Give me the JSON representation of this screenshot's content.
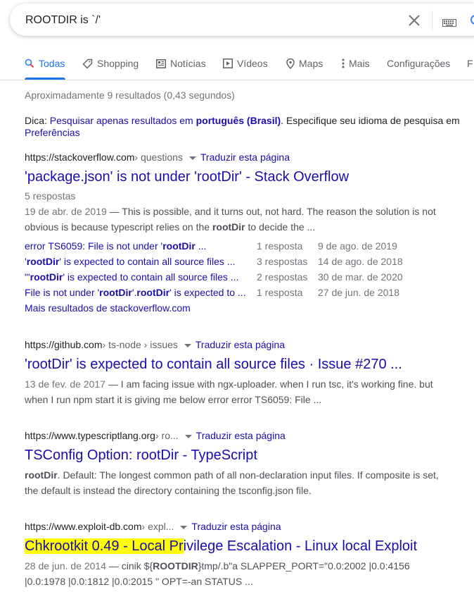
{
  "search": {
    "query": "ROOTDIR is `/'"
  },
  "tabs": [
    {
      "label": "Todas",
      "icon": "search-icon",
      "active": true
    },
    {
      "label": "Shopping",
      "icon": "tag-icon"
    },
    {
      "label": "Notícias",
      "icon": "news-icon"
    },
    {
      "label": "Vídeos",
      "icon": "video-icon"
    },
    {
      "label": "Maps",
      "icon": "map-pin-icon"
    },
    {
      "label": "Mais",
      "icon": "more-vert-icon"
    },
    {
      "label": "Configurações"
    },
    {
      "label": "F"
    }
  ],
  "stats": "Aproximadamente 9 resultados (0,43 segundos)",
  "tip": {
    "prefix": "Dica: ",
    "link1": "Pesquisar apenas resultados em ",
    "lang": "português (Brasil)",
    "middle": ". Especifique seu idioma de pesquisa em ",
    "link2": "Preferências"
  },
  "results": [
    {
      "domain": "https://stackoverflow.com",
      "path": " › questions",
      "translate": "Traduzir esta página",
      "title": "'package.json' is not under 'rootDir' - Stack Overflow",
      "meta": "5 respostas",
      "date": "19 de abr. de 2019",
      "snippet1": " — This is possible, and it turns out, not hard. The reason the solution is not",
      "snippet2a": "obvious is because typescript relies on the ",
      "snippet2b": "rootDir",
      "snippet2c": " to decide the ...",
      "sublinks": [
        {
          "a": "error TS6059: File is not under '",
          "b": "rootDir",
          "c": " ...",
          "answers": "1 resposta",
          "date": "9 de ago. de 2019"
        },
        {
          "a": "'",
          "b": "rootDir",
          "c": "' is expected to contain all source files ...",
          "answers": "3 respostas",
          "date": "14 de ago. de 2018"
        },
        {
          "a": "\"'",
          "b": "rootDir",
          "c": "' is expected to contain all source files ...",
          "answers": "2 respostas",
          "date": "30 de mar. de 2020"
        },
        {
          "a": "File is not under '",
          "b": "rootDir",
          "c": "'.",
          "b2": "rootDir",
          "c2": "' is expected to ...",
          "answers": "1 resposta",
          "date": "27 de jun. de 2018"
        }
      ],
      "more": "Mais resultados de stackoverflow.com"
    },
    {
      "domain": "https://github.com",
      "path": " › ts-node › issues",
      "translate": "Traduzir esta página",
      "title": "'rootDir' is expected to contain all source files · Issue #270 ...",
      "date": "13 de fev. de 2017",
      "snippet1": " — I am facing issue with ngx-uploader. when I run tsc, it's working fine. but",
      "snippet2": "when I run npm start it is giving me below error error TS6059: File ..."
    },
    {
      "domain": "https://www.typescriptlang.org",
      "path": " › ro...",
      "translate": "Traduzir esta página",
      "title": "TSConfig Option: rootDir - TypeScript",
      "snippet1b": "rootDir",
      "snippet1": ". Default: The longest common path of all non-declaration input files. If composite is set,",
      "snippet2": "the default is instead the directory containing the tsconfig.json file."
    },
    {
      "domain": "https://www.exploit-db.com",
      "path": " › expl...",
      "translate": "Traduzir esta página",
      "title_hl": "Chkrootkit 0.49 - Local Pr",
      "title_rest": "ivilege Escalation - Linux local Exploit",
      "date": "28 de jun. de 2014",
      "snippet1a": " — cinik ${",
      "snippet1b": "ROOTDIR",
      "snippet1c": "}tmp/.b\"a SLAPPER_PORT=\"0.0:2002 |0.0:4156",
      "snippet2": "|0.0:1978 |0.0:1812 |0.0:2015 \" OPT=-an STATUS ..."
    }
  ]
}
